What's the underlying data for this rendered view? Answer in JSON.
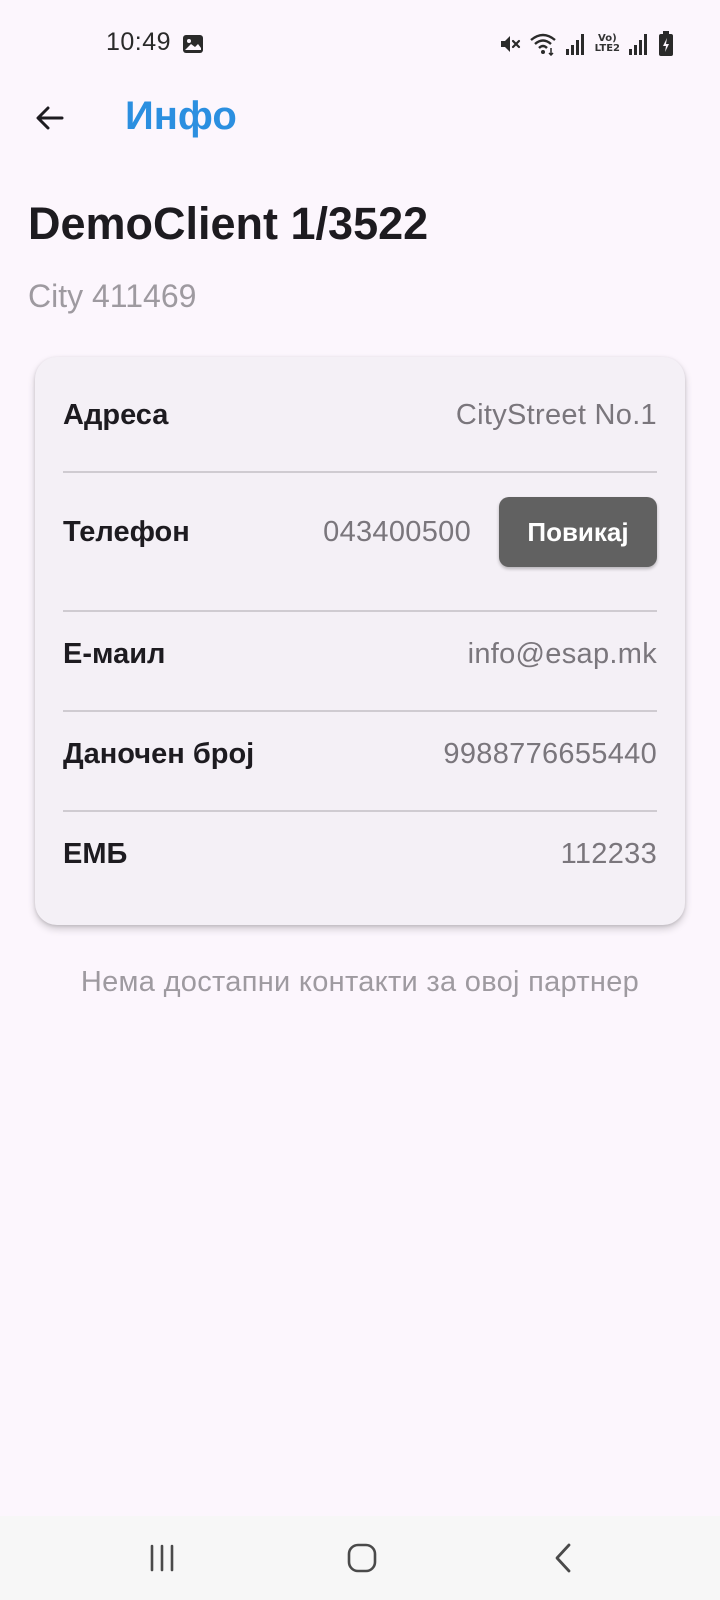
{
  "status_bar": {
    "time": "10:49",
    "lte_label_top": "Vo)",
    "lte_label_bottom": "LTE2",
    "icons": [
      "gallery-icon",
      "mute-icon",
      "wifi-icon",
      "signal-icon",
      "volte-icon",
      "signal-icon",
      "battery-charging-icon"
    ]
  },
  "app_bar": {
    "title": "Инфо",
    "back_icon": "arrow-back-icon",
    "title_color": "#2b8fe0"
  },
  "client": {
    "name": "DemoClient 1/3522",
    "city": "City 411469"
  },
  "details": {
    "address_label": "Адреса",
    "address_value": "CityStreet No.1",
    "phone_label": "Телефон",
    "phone_value": "043400500",
    "call_button_label": "Повикај",
    "email_label": "Е-маил",
    "email_value": "info@esap.mk",
    "tax_label": "Даночен број",
    "tax_value": "9988776655440",
    "emb_label": "ЕМБ",
    "emb_value": "112233"
  },
  "contacts": {
    "empty_message": "Нема достапни контакти за овој партнер"
  },
  "nav_bar": {
    "icons": [
      "recent-apps-icon",
      "home-icon",
      "nav-back-icon"
    ]
  }
}
